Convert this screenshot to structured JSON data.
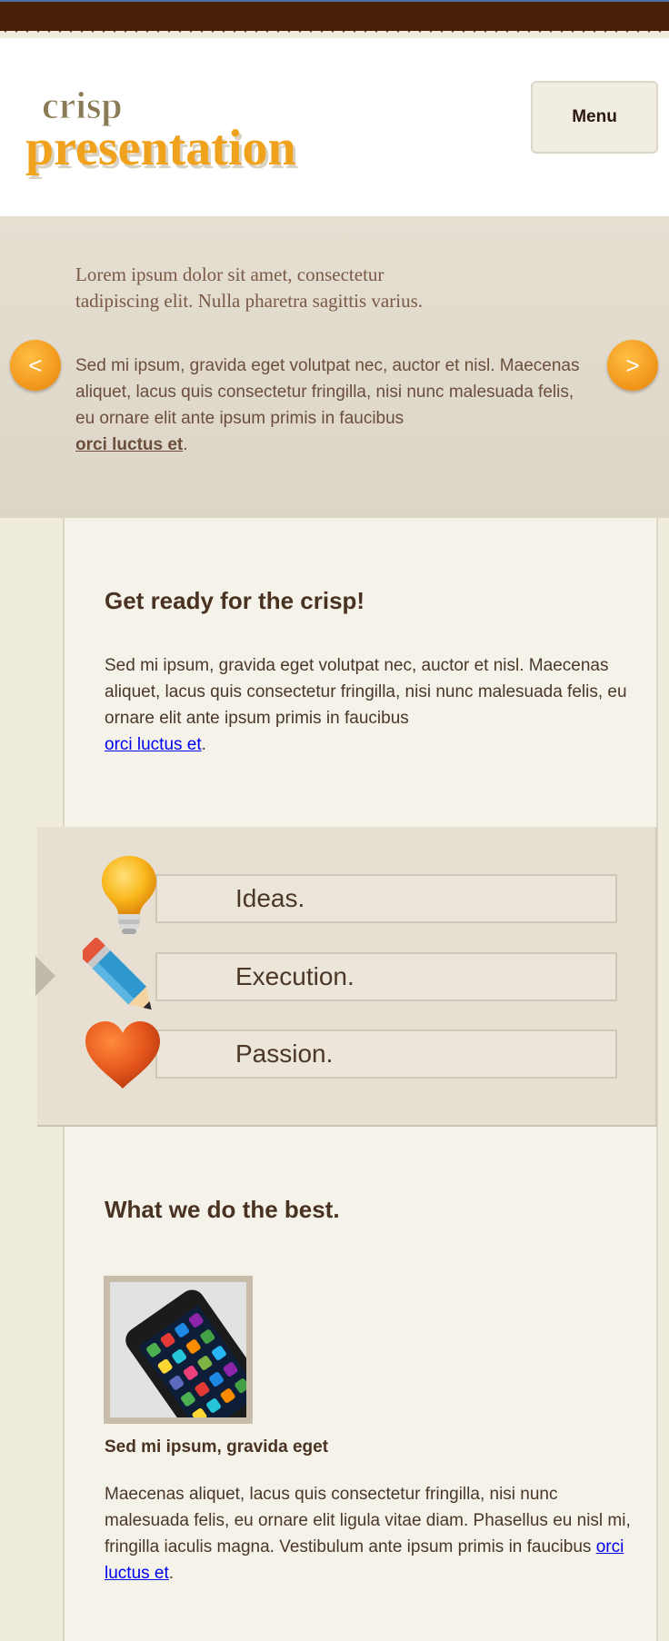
{
  "header": {
    "logo_top": "crisp",
    "logo_bottom": "presentation",
    "menu_label": "Menu"
  },
  "slider": {
    "lead": "Lorem ipsum dolor sit amet, consectetur tadipiscing elit. Nulla pharetra sagittis varius.",
    "body": "Sed mi ipsum, gravida eget volutpat nec, auctor et nisl. Maecenas aliquet, lacus quis consectetur fringilla, nisi nunc malesuada felis, eu ornare elit ante ipsum primis in faucibus",
    "link": "orci luctus et",
    "prev_label": "<",
    "next_label": ">"
  },
  "intro": {
    "title": "Get ready for the crisp!",
    "body": "Sed mi ipsum, gravida eget volutpat nec, auctor et nisl. Maecenas aliquet, lacus quis consectetur fringilla, nisi nunc malesuada felis, eu ornare elit ante ipsum primis in faucibus",
    "link": "orci luctus et"
  },
  "features": [
    {
      "label": "Ideas.",
      "icon": "lightbulb-icon"
    },
    {
      "label": "Execution.",
      "icon": "pencil-icon"
    },
    {
      "label": "Passion.",
      "icon": "heart-icon"
    }
  ],
  "services": {
    "title": "What we do the best.",
    "item_title": "Sed mi ipsum, gravida eget",
    "item_body": "Maecenas aliquet, lacus quis consectetur fringilla, nisi nunc malesuada felis, eu ornare elit ligula vitae diam. Phasellus eu nisl mi, fringilla iaculis magna. Vestibulum ante ipsum primis in faucibus",
    "item_link": "orci luctus et"
  },
  "colors": {
    "accent_orange": "#f29a1e",
    "brown_dark": "#4a1f08",
    "beige_bg": "#efebdd"
  }
}
